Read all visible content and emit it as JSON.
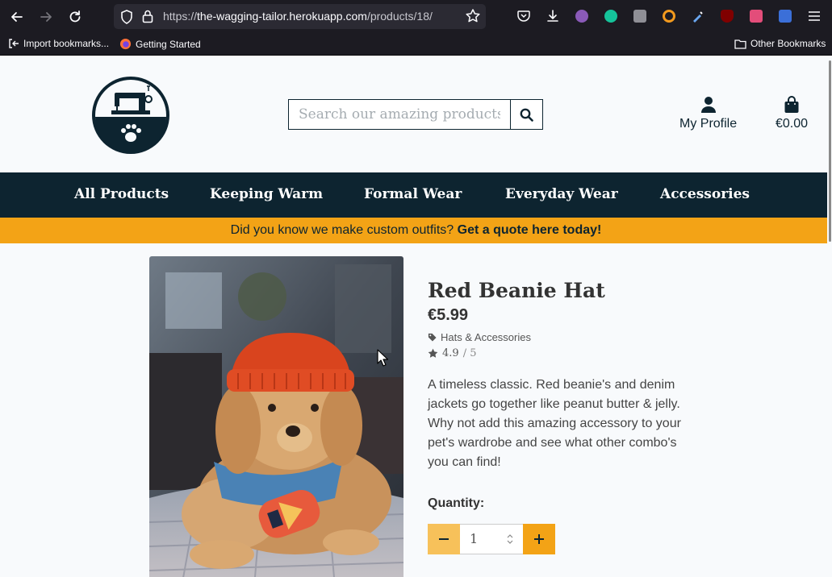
{
  "browser": {
    "url_prefix": "https://",
    "url_host": "the-wagging-tailor.herokuapp.com",
    "url_path": "/products/18/",
    "bookmarks": [
      "Import bookmarks...",
      "Getting Started"
    ],
    "other_bookmarks": "Other Bookmarks"
  },
  "header": {
    "search_placeholder": "Search our amazing products",
    "profile_label": "My Profile",
    "cart_total": "€0.00"
  },
  "nav": {
    "items": [
      "All Products",
      "Keeping Warm",
      "Formal Wear",
      "Everyday Wear",
      "Accessories"
    ]
  },
  "promo": {
    "text": "Did you know we make custom outfits? ",
    "link": "Get a quote here today!"
  },
  "product": {
    "name": "Red Beanie Hat",
    "price": "€5.99",
    "category": "Hats & Accessories",
    "rating": "4.9",
    "rating_max": "/ 5",
    "description": "A timeless classic. Red beanie's and denim jackets go together like peanut butter & jelly. Why not add this amazing accessory to your pet's wardrobe and see what other combo's you can find!",
    "quantity_label": "Quantity:",
    "quantity": "1"
  },
  "colors": {
    "navy": "#0d2430",
    "accent": "#f3a316",
    "accent_light": "#f7c15a",
    "beanie_red": "#d9441e"
  }
}
